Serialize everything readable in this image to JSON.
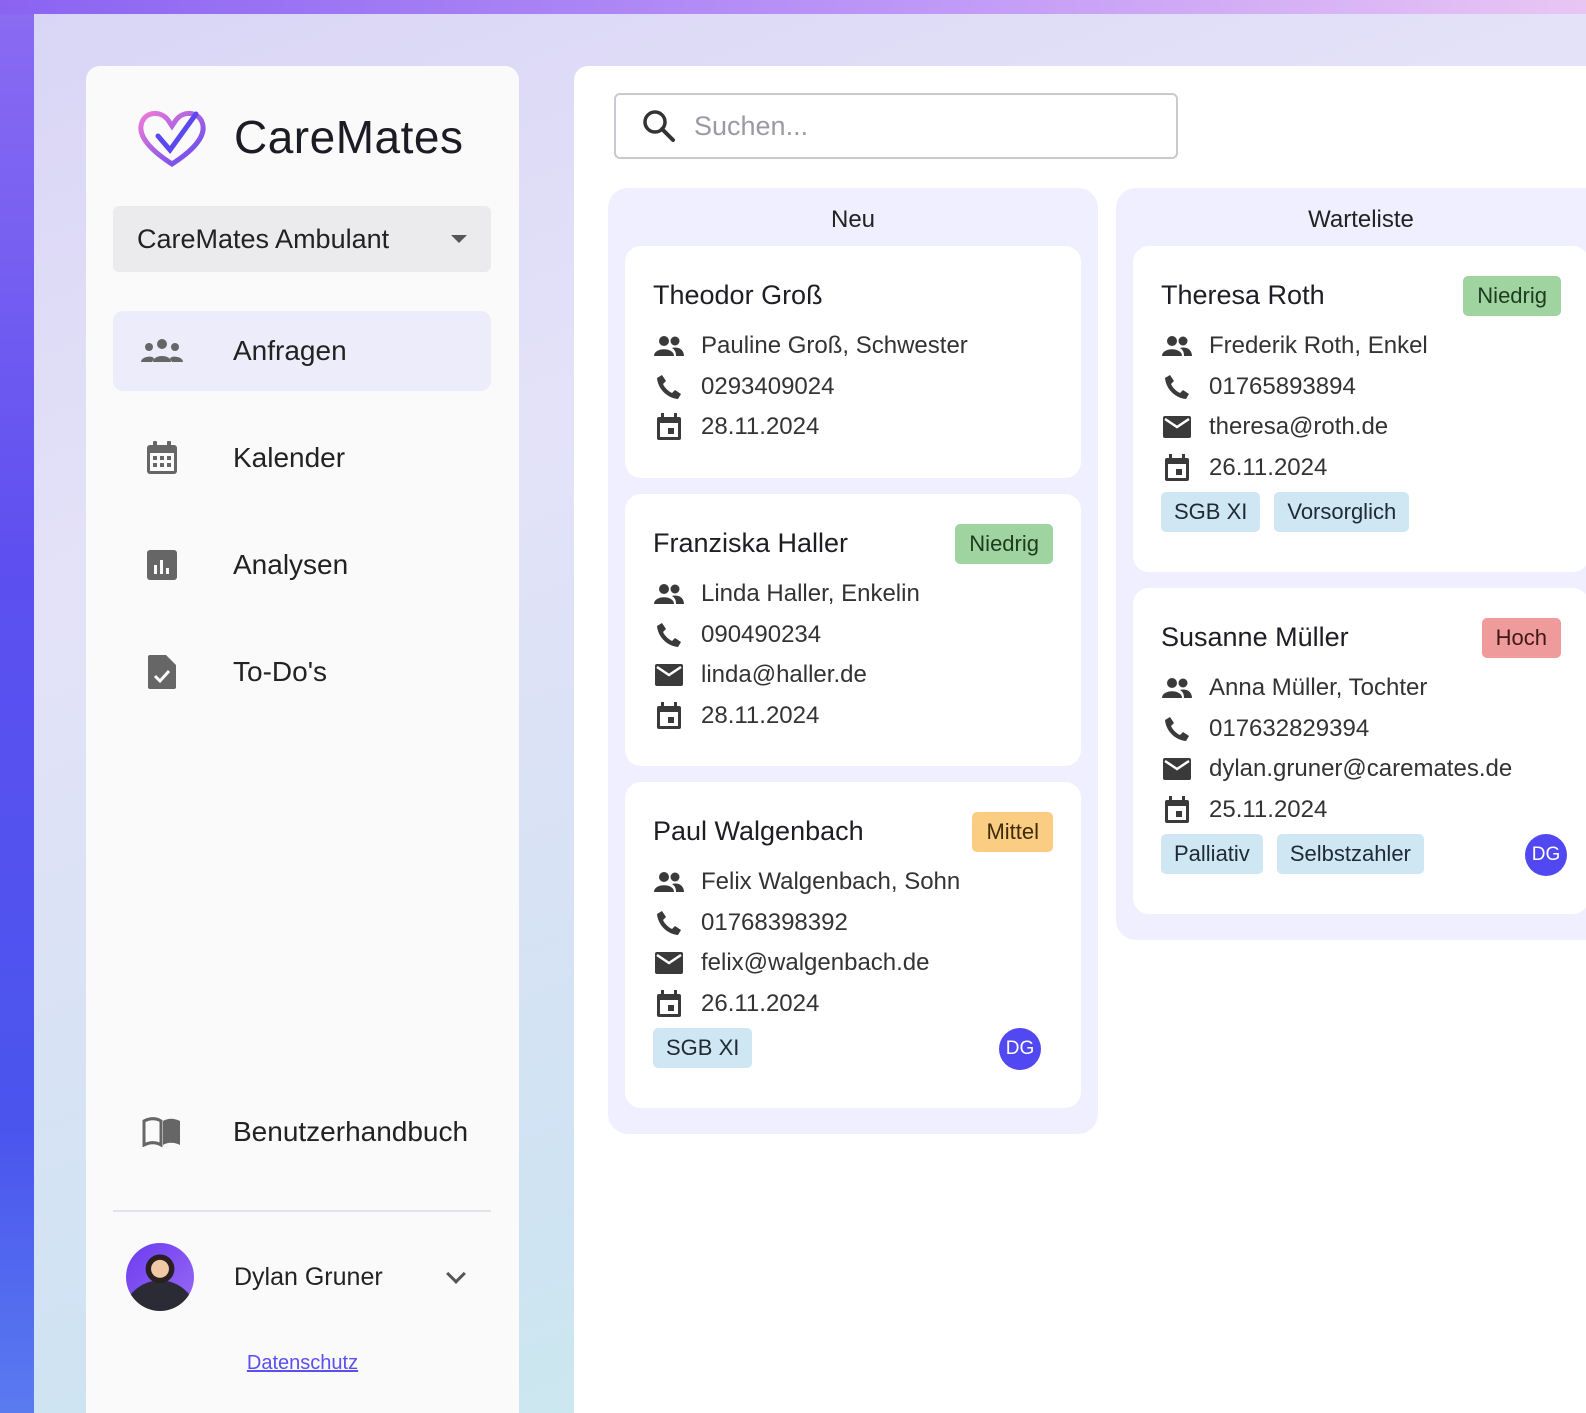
{
  "app": {
    "name": "CareMates"
  },
  "org_select": {
    "value": "CareMates Ambulant"
  },
  "nav": {
    "items": [
      {
        "label": "Anfragen",
        "icon": "people-icon",
        "active": true
      },
      {
        "label": "Kalender",
        "icon": "calendar-icon",
        "active": false
      },
      {
        "label": "Analysen",
        "icon": "chart-icon",
        "active": false
      },
      {
        "label": "To-Do's",
        "icon": "todo-file-icon",
        "active": false
      }
    ],
    "manual": {
      "label": "Benutzerhandbuch",
      "icon": "book-icon"
    }
  },
  "user": {
    "name": "Dylan Gruner"
  },
  "footer": {
    "privacy": "Datenschutz"
  },
  "search": {
    "placeholder": "Suchen..."
  },
  "columns": [
    {
      "title": "Neu",
      "cards": [
        {
          "name": "Theodor Groß",
          "priority": "",
          "contact": "Pauline Groß, Schwester",
          "phone": "0293409024",
          "email": "",
          "date": "28.11.2024",
          "tags": [],
          "assignee": ""
        },
        {
          "name": "Franziska Haller",
          "priority": "Niedrig",
          "contact": "Linda Haller, Enkelin",
          "phone": "090490234",
          "email": "linda@haller.de",
          "date": "28.11.2024",
          "tags": [],
          "assignee": ""
        },
        {
          "name": "Paul Walgenbach",
          "priority": "Mittel",
          "contact": "Felix Walgenbach, Sohn",
          "phone": "01768398392",
          "email": "felix@walgenbach.de",
          "date": "26.11.2024",
          "tags": [
            "SGB XI"
          ],
          "assignee": "DG"
        }
      ]
    },
    {
      "title": "Warteliste",
      "cards": [
        {
          "name": "Theresa Roth",
          "priority": "Niedrig",
          "contact": "Frederik Roth, Enkel",
          "phone": "01765893894",
          "email": "theresa@roth.de",
          "date": "26.11.2024",
          "tags": [
            "SGB XI",
            "Vorsorglich"
          ],
          "assignee": ""
        },
        {
          "name": "Susanne Müller",
          "priority": "Hoch",
          "contact": "Anna Müller, Tochter",
          "phone": "017632829394",
          "email": "dylan.gruner@caremates.de",
          "date": "25.11.2024",
          "tags": [
            "Palliativ",
            "Selbstzahler"
          ],
          "assignee": "DG"
        }
      ]
    }
  ],
  "colors": {
    "accent": "#5148f2",
    "priority_low": "#9fd39f",
    "priority_mid": "#fbcd82",
    "priority_high": "#ef9b9b",
    "tag": "#cfe6f3"
  }
}
